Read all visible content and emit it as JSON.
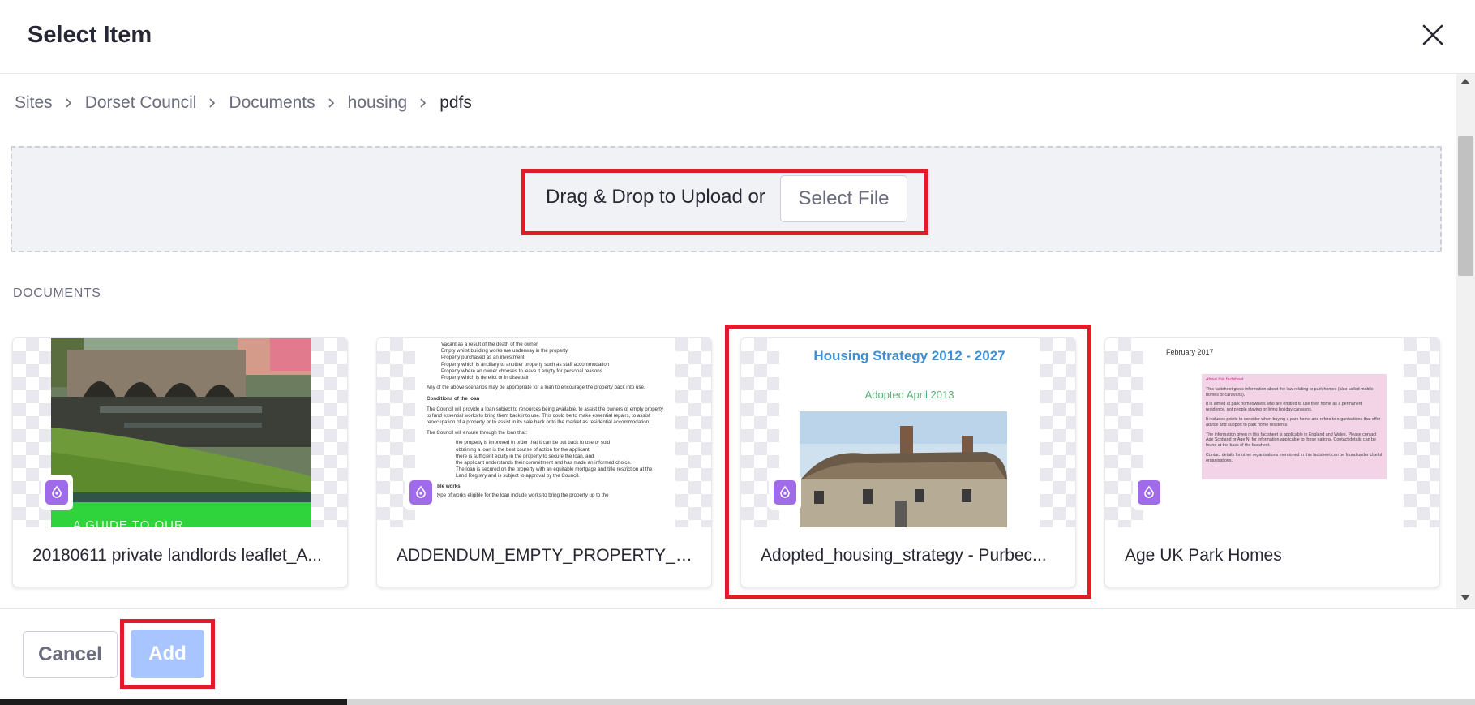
{
  "header": {
    "title": "Select Item",
    "close_icon": "close-icon"
  },
  "breadcrumb": {
    "items": [
      "Sites",
      "Dorset Council",
      "Documents",
      "housing",
      "pdfs"
    ],
    "separator_icon": "chevron-right-icon"
  },
  "upload": {
    "drop_text": "Drag & Drop to Upload or",
    "select_file_label": "Select File"
  },
  "documents": {
    "section_label": "DOCUMENTS",
    "cards": [
      {
        "title": "20180611 private landlords leaflet_A...",
        "type_icon": "pdf-icon",
        "preview_text": "A GUIDE TO OUR"
      },
      {
        "title": "ADDENDUM_EMPTY_PROPERTY_LO...",
        "type_icon": "pdf-icon",
        "preview_lines": [
          "Vacant as a result of the death of the owner",
          "Empty whilst building works are underway in the property",
          "Property purchased as an investment",
          "Property which is ancillary to another property such as staff accommodation",
          "Property where an owner chooses to leave it empty for personal reasons",
          "Property which is derelict or in disrepair",
          "Any of the above scenarios may be appropriate for a loan to encourage the property back into use.",
          "Conditions of the loan",
          "The Council will provide a loan subject to resources being available, to assist the owners of empty property to fund essential works to bring them back into use. This could be to make essential repairs, to assist reoccupation of a property or to assist in its sale back onto the market as residential accommodation.",
          "The Council will ensure through the loan that:",
          "the property is improved in order that it can be put back to use or sold",
          "obtaining a loan is the best course of action for the applicant",
          "there is sufficient equity in the property to secure the loan, and",
          "the applicant understands their commitment and has made an informed choice.",
          "The loan is secured on the property with an equitable mortgage and title restriction at the Land Registry and is subject to approval by the Council.",
          "Eligible works",
          "The type of works eligible for the loan include works to bring the property up to the"
        ]
      },
      {
        "title": "Adopted_housing_strategy - Purbec...",
        "type_icon": "pdf-icon",
        "preview_heading": "Housing Strategy 2012 - 2027",
        "preview_subheading": "Adopted April 2013"
      },
      {
        "title": "Age UK Park Homes",
        "type_icon": "pdf-icon",
        "preview_date": "February 2017",
        "preview_box_title": "About this factsheet",
        "preview_box_lines": [
          "This factsheet gives information about the law relating to park homes (also called mobile homes or caravans).",
          "It is aimed at park homeowners who are entitled to use their home as a permanent residence, not people staying or living holiday caravans.",
          "It includes points to consider when buying a park home and refers to organisations that offer advice and support to park home residents.",
          "The information given in this factsheet is applicable in England and Wales. Please contact Age Scotland or Age NI for information applicable to those nations. Contact details can be found at the back of the factsheet.",
          "Contact details for other organisations mentioned in this factsheet can be found under Useful organisations."
        ]
      }
    ]
  },
  "footer": {
    "cancel_label": "Cancel",
    "add_label": "Add"
  },
  "colors": {
    "highlight": "#e21b2b",
    "primary_disabled": "#a9c5ff",
    "pdf_badge": "#9f6bea"
  }
}
